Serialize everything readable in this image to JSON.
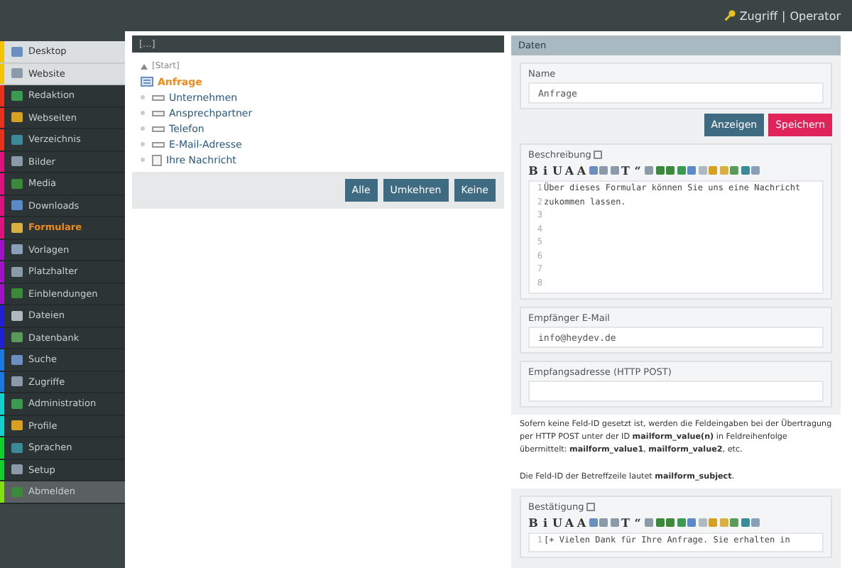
{
  "topbar": {
    "user_link": "Zugriff",
    "separator": "|",
    "user": "Operator"
  },
  "sidebar": {
    "items": [
      {
        "label": "Desktop",
        "kind": "light",
        "color": "#f2c500",
        "selected": false
      },
      {
        "label": "Website",
        "kind": "light",
        "color": "#f2c500",
        "selected": false
      },
      {
        "label": "Redaktion",
        "kind": "dark",
        "color": "#e8301c",
        "selected": false
      },
      {
        "label": "Webseiten",
        "kind": "dark",
        "color": "#e8301c",
        "selected": false
      },
      {
        "label": "Verzeichnis",
        "kind": "dark",
        "color": "#e8301c",
        "selected": false
      },
      {
        "label": "Bilder",
        "kind": "dark",
        "color": "#e0117f",
        "selected": false
      },
      {
        "label": "Media",
        "kind": "dark",
        "color": "#e0117f",
        "selected": false
      },
      {
        "label": "Downloads",
        "kind": "dark",
        "color": "#e0117f",
        "selected": false
      },
      {
        "label": "Formulare",
        "kind": "dark",
        "color": "#e0117f",
        "selected": true
      },
      {
        "label": "Vorlagen",
        "kind": "dark",
        "color": "#a010c8",
        "selected": false
      },
      {
        "label": "Platzhalter",
        "kind": "dark",
        "color": "#a010c8",
        "selected": false
      },
      {
        "label": "Einblendungen",
        "kind": "dark",
        "color": "#a010c8",
        "selected": false
      },
      {
        "label": "Dateien",
        "kind": "dark",
        "color": "#2020d8",
        "selected": false
      },
      {
        "label": "Datenbank",
        "kind": "dark",
        "color": "#2020d8",
        "selected": false
      },
      {
        "label": "Suche",
        "kind": "dark",
        "color": "#1a78e0",
        "selected": false
      },
      {
        "label": "Zugriffe",
        "kind": "dark",
        "color": "#1a78e0",
        "selected": false
      },
      {
        "label": "Administration",
        "kind": "dark",
        "color": "#10d0d0",
        "selected": false
      },
      {
        "label": "Profile",
        "kind": "dark",
        "color": "#10d0d0",
        "selected": false
      },
      {
        "label": "Sprachen",
        "kind": "dark",
        "color": "#10d030",
        "selected": false
      },
      {
        "label": "Setup",
        "kind": "dark",
        "color": "#10d030",
        "selected": false
      },
      {
        "label": "Abmelden",
        "kind": "logout",
        "color": "#80e010",
        "selected": false
      }
    ]
  },
  "tree_panel": {
    "title": "[...]",
    "tree": [
      {
        "label": "[Start]",
        "kind": "up",
        "selected": false
      },
      {
        "label": "Anfrage",
        "kind": "form",
        "selected": true,
        "children": [
          {
            "label": "Unternehmen",
            "kind": "input",
            "selected": false
          },
          {
            "label": "Ansprechpartner",
            "kind": "input",
            "selected": false
          },
          {
            "label": "Telefon",
            "kind": "input",
            "selected": false
          },
          {
            "label": "E-Mail-Adresse",
            "kind": "input",
            "selected": false
          },
          {
            "label": "Ihre Nachricht",
            "kind": "textarea",
            "selected": false
          }
        ]
      }
    ],
    "buttons": [
      "Alle",
      "Umkehren",
      "Keine"
    ]
  },
  "data_panel": {
    "title": "Daten",
    "name": {
      "label": "Name",
      "value": "Anfrage"
    },
    "buttons": [
      {
        "label": "Anzeigen",
        "kind": "secondary"
      },
      {
        "label": "Speichern",
        "kind": "primary"
      }
    ],
    "description": {
      "label": "Beschreibung",
      "toolbar": [
        {
          "kind": "text",
          "label": "B"
        },
        {
          "kind": "text",
          "label": "i"
        },
        {
          "kind": "text",
          "label": "U"
        },
        {
          "kind": "text",
          "label": "A"
        },
        {
          "kind": "text",
          "label": "A"
        },
        {
          "kind": "icon"
        },
        {
          "kind": "icon"
        },
        {
          "kind": "icon"
        },
        {
          "kind": "text",
          "label": "T"
        },
        {
          "kind": "text",
          "label": "“"
        },
        {
          "kind": "icon"
        },
        {
          "kind": "icon"
        },
        {
          "kind": "icon"
        },
        {
          "kind": "icon"
        },
        {
          "kind": "icon"
        },
        {
          "kind": "icon"
        },
        {
          "kind": "icon"
        },
        {
          "kind": "icon"
        },
        {
          "kind": "icon"
        },
        {
          "kind": "icon"
        },
        {
          "kind": "icon"
        }
      ],
      "lines": [
        {
          "number": "1",
          "text": "Über dieses Formular können Sie uns eine Nachricht"
        },
        {
          "number": "2",
          "text": "zukommen lassen."
        },
        {
          "number": "3"
        },
        {
          "number": "4"
        },
        {
          "number": "5"
        },
        {
          "number": "6"
        },
        {
          "number": "7"
        },
        {
          "number": "8"
        }
      ]
    },
    "recipient_email": {
      "label": "Empfänger E-Mail",
      "value": "info@heydev.de"
    },
    "post_address": {
      "label": "Empfangsadresse (HTTP POST)"
    },
    "info": [
      "Sofern keine Feld-ID gesetzt ist, werden die Feldeingaben bei der Übertragung per HTTP POST unter der ID **mailform_value(n)** in Feldreihenfolge übermittelt: **mailform_value1**, **mailform_value2**, etc.",
      "Die Feld-ID der Betreffzeile lautet **mailform_subject**."
    ],
    "confirmation": {
      "label": "Bestätigung",
      "toolbar": [
        {
          "kind": "text",
          "label": "B"
        },
        {
          "kind": "text",
          "label": "i"
        },
        {
          "kind": "text",
          "label": "U"
        },
        {
          "kind": "text",
          "label": "A"
        },
        {
          "kind": "text",
          "label": "A"
        },
        {
          "kind": "icon"
        },
        {
          "kind": "icon"
        },
        {
          "kind": "icon"
        },
        {
          "kind": "text",
          "label": "T"
        },
        {
          "kind": "text",
          "label": "“"
        },
        {
          "kind": "icon"
        },
        {
          "kind": "icon"
        },
        {
          "kind": "icon"
        },
        {
          "kind": "icon"
        },
        {
          "kind": "icon"
        },
        {
          "kind": "icon"
        },
        {
          "kind": "icon"
        },
        {
          "kind": "icon"
        },
        {
          "kind": "icon"
        },
        {
          "kind": "icon"
        },
        {
          "kind": "icon"
        }
      ],
      "lines": [
        {
          "number": "1",
          "text": "[+ Vielen Dank für Ihre Anfrage. Sie erhalten in"
        }
      ]
    }
  }
}
